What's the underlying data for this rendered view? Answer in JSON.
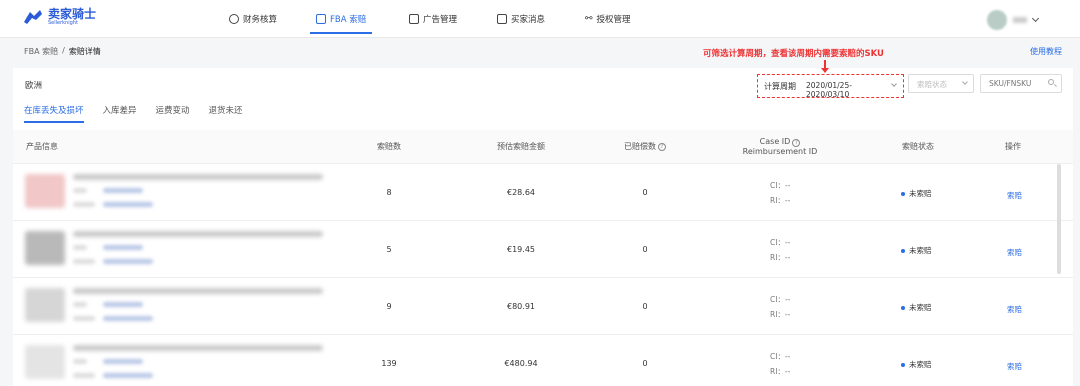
{
  "brand": {
    "name": "卖家骑士",
    "tagline": "Sellerknight"
  },
  "nav": [
    {
      "label": "财务核算",
      "icon": "dollar-circle-icon"
    },
    {
      "label": "FBA 索赔",
      "icon": "claim-box-icon",
      "active": true
    },
    {
      "label": "广告管理",
      "icon": "ad-icon"
    },
    {
      "label": "买家消息",
      "icon": "message-icon"
    },
    {
      "label": "授权管理",
      "icon": "link-icon"
    }
  ],
  "breadcrumb": {
    "parent": "FBA 索赔",
    "sep": "/",
    "current": "索赔详情"
  },
  "help_link": "使用教程",
  "region": "欧洲",
  "tabs": [
    "在库丢失及损坏",
    "入库差异",
    "运费变动",
    "退货未还"
  ],
  "annotation": "可筛选计算周期，查看该周期内需要索赔的SKU",
  "filters": {
    "period_label": "计算周期",
    "period_value": "2020/01/25-2020/03/10",
    "status_placeholder": "索赔状态",
    "sku_placeholder": "SKU/FNSKU"
  },
  "table": {
    "headers": {
      "product": "产品信息",
      "count": "索赔数",
      "amount": "预估索赔金额",
      "paid": "已赔偿数",
      "case_id": "Case ID",
      "reimb_id": "Reimbursement ID",
      "status": "索赔状态",
      "action": "操作"
    },
    "rows": [
      {
        "count": "8",
        "amount": "€28.64",
        "paid": "0",
        "ci": "CI：--",
        "ri": "RI：--",
        "status": "未索赔",
        "action": "索赔"
      },
      {
        "count": "5",
        "amount": "€19.45",
        "paid": "0",
        "ci": "CI：--",
        "ri": "RI：--",
        "status": "未索赔",
        "action": "索赔"
      },
      {
        "count": "9",
        "amount": "€80.91",
        "paid": "0",
        "ci": "CI：--",
        "ri": "RI：--",
        "status": "未索赔",
        "action": "索赔"
      },
      {
        "count": "139",
        "amount": "€480.94",
        "paid": "0",
        "ci": "CI：--",
        "ri": "RI：--",
        "status": "未索赔",
        "action": "索赔"
      }
    ]
  },
  "colors": {
    "accent": "#2b6de5",
    "annotation": "#e33333"
  }
}
